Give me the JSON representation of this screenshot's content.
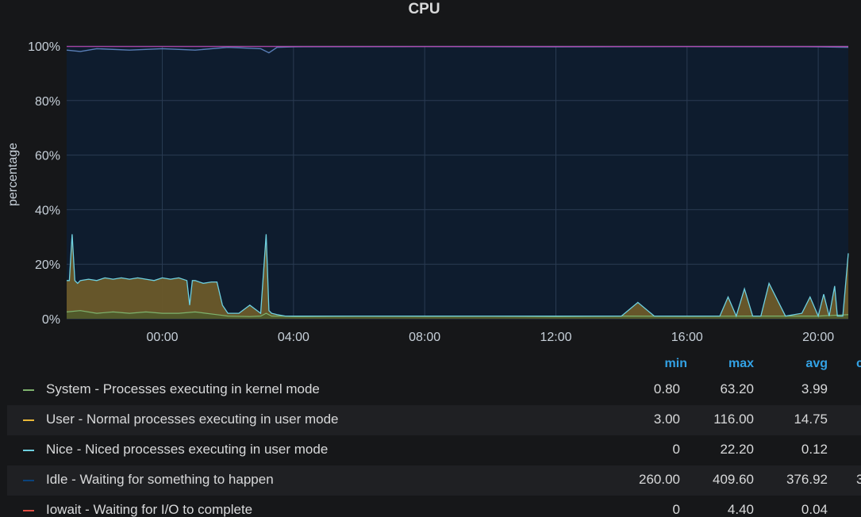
{
  "panel": {
    "title": "CPU"
  },
  "chart_data": {
    "type": "area",
    "title": "CPU",
    "ylabel": "percentage",
    "xlabel": "",
    "ylim": [
      0,
      100
    ],
    "y_ticks": [
      "0%",
      "20%",
      "40%",
      "60%",
      "80%",
      "100%"
    ],
    "x_ticks": [
      "00:00",
      "04:00",
      "08:00",
      "12:00",
      "16:00",
      "20:00"
    ],
    "grid": true,
    "legend_placement": "bottom-table",
    "colors": {
      "background": "#161719",
      "plot_bg": "#0e1c2e",
      "system": "#7eb26d",
      "user": "#eab839",
      "nice": "#6ed0e0",
      "idle": "#0a437c",
      "iowait": "#e24d42",
      "top": "#ba43a9"
    },
    "series": [
      {
        "name": "System - Processes executing in kernel mode",
        "x": [
          "21:05",
          "21:30",
          "22:00",
          "22:30",
          "23:00",
          "23:30",
          "00:00",
          "00:30",
          "01:00",
          "01:20",
          "01:40",
          "02:00",
          "02:40",
          "03:00",
          "03:10",
          "03:20",
          "03:40",
          "04:00",
          "06:00",
          "08:00",
          "10:00",
          "12:00",
          "14:00",
          "16:00",
          "18:00",
          "20:00",
          "20:55"
        ],
        "values": [
          2.5,
          3,
          2,
          2.5,
          2,
          2.5,
          2,
          2,
          2.5,
          2,
          1.5,
          1,
          0.8,
          1,
          2,
          1,
          1,
          0.8,
          1,
          0.9,
          1,
          0.8,
          1,
          0.9,
          1,
          1,
          1.5
        ]
      },
      {
        "name": "User - Normal processes executing in user mode",
        "x": [
          "21:05",
          "21:10",
          "21:15",
          "21:20",
          "21:25",
          "21:30",
          "21:45",
          "22:00",
          "22:15",
          "22:30",
          "22:45",
          "23:00",
          "23:15",
          "23:30",
          "23:45",
          "00:00",
          "00:15",
          "00:30",
          "00:45",
          "00:50",
          "00:55",
          "01:00",
          "01:15",
          "01:30",
          "01:40",
          "01:50",
          "02:00",
          "02:20",
          "02:40",
          "03:00",
          "03:10",
          "03:15",
          "03:20",
          "03:30",
          "03:45",
          "04:00",
          "05:00",
          "06:00",
          "07:00",
          "08:00",
          "09:00",
          "10:00",
          "11:00",
          "12:00",
          "13:00",
          "14:00",
          "14:30",
          "15:00",
          "16:00",
          "17:00",
          "17:15",
          "17:30",
          "17:45",
          "18:00",
          "18:15",
          "18:30",
          "19:00",
          "19:30",
          "19:45",
          "20:00",
          "20:10",
          "20:20",
          "20:30",
          "20:35",
          "20:45",
          "20:55"
        ],
        "values": [
          14,
          14,
          31,
          14,
          13,
          14,
          14.5,
          14,
          15,
          14.5,
          15,
          14.5,
          15,
          14.5,
          14,
          15,
          14.5,
          15,
          14,
          5,
          14,
          14,
          13,
          13.5,
          13.5,
          5,
          2,
          2,
          5,
          2,
          31,
          3,
          2,
          1.5,
          1,
          1,
          1,
          1,
          1,
          1,
          1,
          1,
          1,
          1,
          1,
          1,
          6,
          1,
          1,
          1,
          8,
          1,
          11,
          1,
          1,
          13,
          1,
          2,
          8,
          1,
          9,
          1,
          12,
          1,
          1,
          24
        ]
      },
      {
        "name": "Nice - Niced processes executing in user mode",
        "x": [
          "21:05",
          "20:55"
        ],
        "values": [
          0,
          0
        ]
      },
      {
        "name": "Idle - Waiting for something to happen",
        "x": [
          "21:05",
          "21:30",
          "22:00",
          "23:00",
          "00:00",
          "01:00",
          "02:00",
          "03:00",
          "03:15",
          "03:30",
          "04:00",
          "08:00",
          "12:00",
          "16:00",
          "20:00",
          "20:55"
        ],
        "values": [
          98.5,
          98,
          99,
          98.5,
          99,
          98.5,
          99.5,
          99,
          97.5,
          99.5,
          99.7,
          99.8,
          99.7,
          99.8,
          99.7,
          99.5
        ]
      },
      {
        "name": "Iowait - Waiting for I/O to complete",
        "x": [
          "21:05",
          "20:55"
        ],
        "values": [
          0,
          0
        ]
      }
    ]
  },
  "legend": {
    "headers": {
      "min": "min",
      "max": "max",
      "avg": "avg",
      "extra": "c"
    },
    "rows": [
      {
        "name": "System - Processes executing in kernel mode",
        "min": "0.80",
        "max": "63.20",
        "avg": "3.99",
        "extra": "",
        "color": "#7eb26d"
      },
      {
        "name": "User - Normal processes executing in user mode",
        "min": "3.00",
        "max": "116.00",
        "avg": "14.75",
        "extra": "",
        "color": "#eab839"
      },
      {
        "name": "Nice - Niced processes executing in user mode",
        "min": "0",
        "max": "22.20",
        "avg": "0.12",
        "extra": "",
        "color": "#6ed0e0"
      },
      {
        "name": "Idle - Waiting for something to happen",
        "min": "260.00",
        "max": "409.60",
        "avg": "376.92",
        "extra": "3",
        "color": "#0a437c"
      },
      {
        "name": "Iowait - Waiting for I/O to complete",
        "min": "0",
        "max": "4.40",
        "avg": "0.04",
        "extra": "",
        "color": "#e24d42"
      }
    ]
  }
}
